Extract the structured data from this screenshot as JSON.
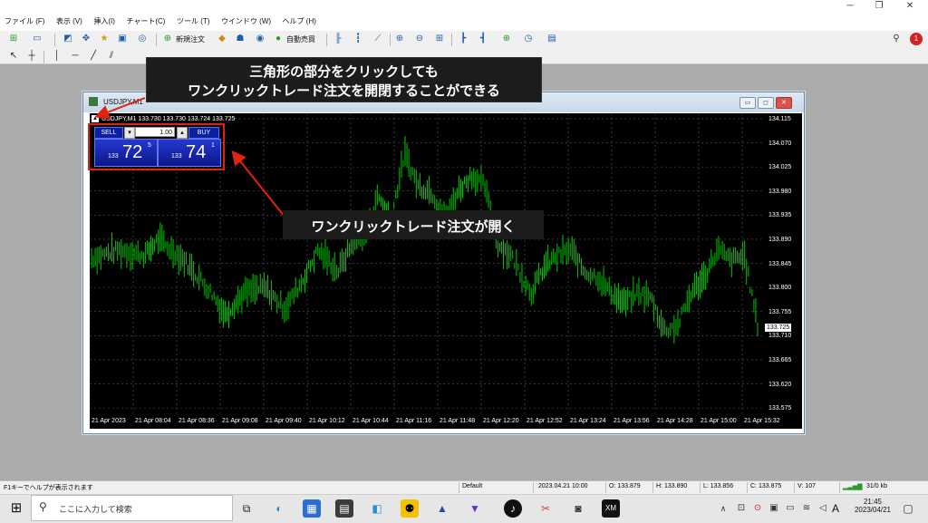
{
  "menu": [
    "ファイル (F)",
    "表示 (V)",
    "挿入(I)",
    "チャート(C)",
    "ツール (T)",
    "ウインドウ (W)",
    "ヘルプ (H)"
  ],
  "toolbar": {
    "new_order": "新規注文",
    "auto_trade": "自動売買"
  },
  "annotations": {
    "top_line1": "三角形の部分をクリックしても",
    "top_line2": "ワンクリックトレード注文を開閉することができる",
    "middle": "ワンクリックトレード注文が開く"
  },
  "chart_window": {
    "title": "USDJPY,M1",
    "header": "USDJPY,M1  133.730 133.730 133.724 133.725"
  },
  "one_click": {
    "sell_label": "SELL",
    "buy_label": "BUY",
    "lot": "1.00",
    "sell_prefix": "133",
    "sell_main": "72",
    "sell_sup": "5",
    "buy_prefix": "133",
    "buy_main": "74",
    "buy_sup": "1"
  },
  "chart_data": {
    "type": "bar",
    "symbol": "USDJPY",
    "timeframe": "M1",
    "current_price": "133.725",
    "y_ticks": [
      "134.115",
      "134.070",
      "134.025",
      "133.980",
      "133.935",
      "133.890",
      "133.845",
      "133.800",
      "133.755",
      "133.710",
      "133.665",
      "133.620",
      "133.575"
    ],
    "x_ticks": [
      "21 Apr 2023",
      "21 Apr 08:04",
      "21 Apr 08:36",
      "21 Apr 09:08",
      "21 Apr 09:40",
      "21 Apr 10:12",
      "21 Apr 10:44",
      "21 Apr 11:16",
      "21 Apr 11:48",
      "21 Apr 12:20",
      "21 Apr 12:52",
      "21 Apr 13:24",
      "21 Apr 13:56",
      "21 Apr 14:28",
      "21 Apr 15:00",
      "21 Apr 15:32"
    ],
    "ylim": [
      133.56,
      134.125
    ],
    "grid": true,
    "colors": {
      "bars": "#00c800",
      "background": "#000000",
      "grid": "#5a5a5a"
    },
    "approx_path": [
      [
        0,
        133.855
      ],
      [
        0.04,
        133.87
      ],
      [
        0.08,
        133.86
      ],
      [
        0.1,
        133.89
      ],
      [
        0.14,
        133.85
      ],
      [
        0.18,
        133.79
      ],
      [
        0.2,
        133.75
      ],
      [
        0.23,
        133.79
      ],
      [
        0.26,
        133.8
      ],
      [
        0.29,
        133.76
      ],
      [
        0.32,
        133.82
      ],
      [
        0.34,
        133.87
      ],
      [
        0.37,
        133.83
      ],
      [
        0.39,
        133.88
      ],
      [
        0.41,
        133.9
      ],
      [
        0.43,
        133.97
      ],
      [
        0.45,
        133.93
      ],
      [
        0.47,
        134.05
      ],
      [
        0.49,
        133.99
      ],
      [
        0.51,
        133.98
      ],
      [
        0.53,
        133.93
      ],
      [
        0.55,
        133.98
      ],
      [
        0.57,
        134.01
      ],
      [
        0.59,
        133.99
      ],
      [
        0.61,
        133.88
      ],
      [
        0.63,
        133.86
      ],
      [
        0.66,
        133.79
      ],
      [
        0.68,
        133.84
      ],
      [
        0.7,
        133.86
      ],
      [
        0.72,
        133.87
      ],
      [
        0.74,
        133.83
      ],
      [
        0.76,
        133.82
      ],
      [
        0.78,
        133.79
      ],
      [
        0.8,
        133.77
      ],
      [
        0.82,
        133.79
      ],
      [
        0.84,
        133.78
      ],
      [
        0.86,
        133.72
      ],
      [
        0.88,
        133.73
      ],
      [
        0.9,
        133.79
      ],
      [
        0.92,
        133.82
      ],
      [
        0.94,
        133.87
      ],
      [
        0.96,
        133.85
      ],
      [
        0.98,
        133.86
      ],
      [
        1.0,
        133.73
      ]
    ]
  },
  "status": {
    "help": "F1キーでヘルプが表示されます",
    "profile": "Default",
    "datetime": "2023.04.21 10:00",
    "open": "O: 133.879",
    "high": "H: 133.890",
    "low": "L: 133.856",
    "close": "C: 133.875",
    "volume": "V: 107",
    "traffic": "31/0 kb"
  },
  "taskbar": {
    "search_placeholder": "ここに入力して検索",
    "time": "21:45",
    "date": "2023/04/21",
    "ime": "A"
  }
}
